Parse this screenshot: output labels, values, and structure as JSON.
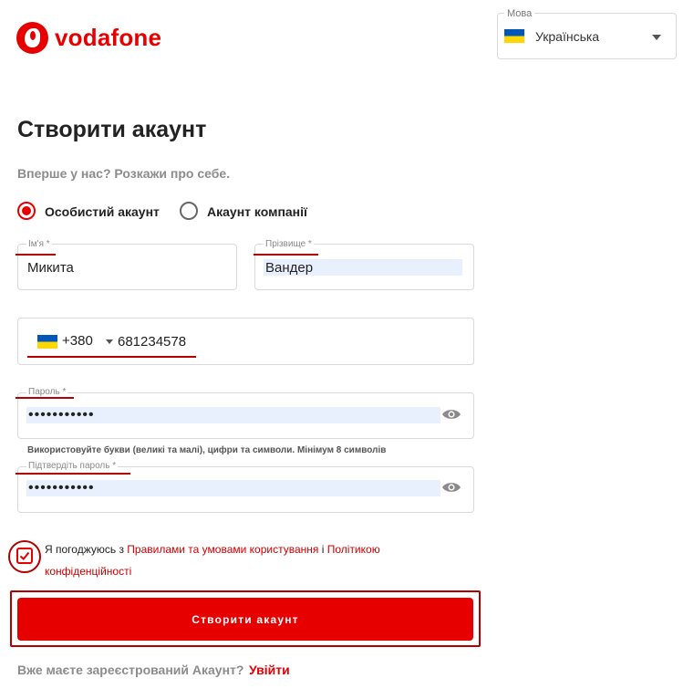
{
  "brand": {
    "name": "vodafone",
    "color": "#e60000"
  },
  "language": {
    "legend": "Мова",
    "value": "Українська",
    "flag_icon": "ukraine-flag-icon"
  },
  "page": {
    "title": "Створити акаунт",
    "subtitle": "Вперше у нас? Розкажи про себе."
  },
  "account_type": {
    "options": [
      {
        "label": "Особистий акаунт",
        "selected": true
      },
      {
        "label": "Акаунт компанії",
        "selected": false
      }
    ]
  },
  "form": {
    "first_name": {
      "legend": "Ім'я *",
      "value": "Микита"
    },
    "last_name": {
      "legend": "Прізвище *",
      "value": "Вандер"
    },
    "phone": {
      "country_code": "+380",
      "number": "681234578",
      "flag_icon": "ukraine-flag-icon"
    },
    "password": {
      "legend": "Пароль *",
      "value": "•••••••••••"
    },
    "password_hint": "Використовуйте букви (великі та малі), цифри та символи. Мінімум 8 символів",
    "confirm_password": {
      "legend": "Підтвердіть пароль *",
      "value": "•••••••••••"
    }
  },
  "consent": {
    "checked": true,
    "prefix": "Я погоджуюсь з ",
    "terms_link": "Правилами та умовами користування",
    "joiner": " і ",
    "privacy_link": "Політикою конфіденційності"
  },
  "submit": {
    "label": "Створити акаунт"
  },
  "login": {
    "question": "Вже маєте зареєстрований Акаунт?",
    "link": "Увійти"
  }
}
